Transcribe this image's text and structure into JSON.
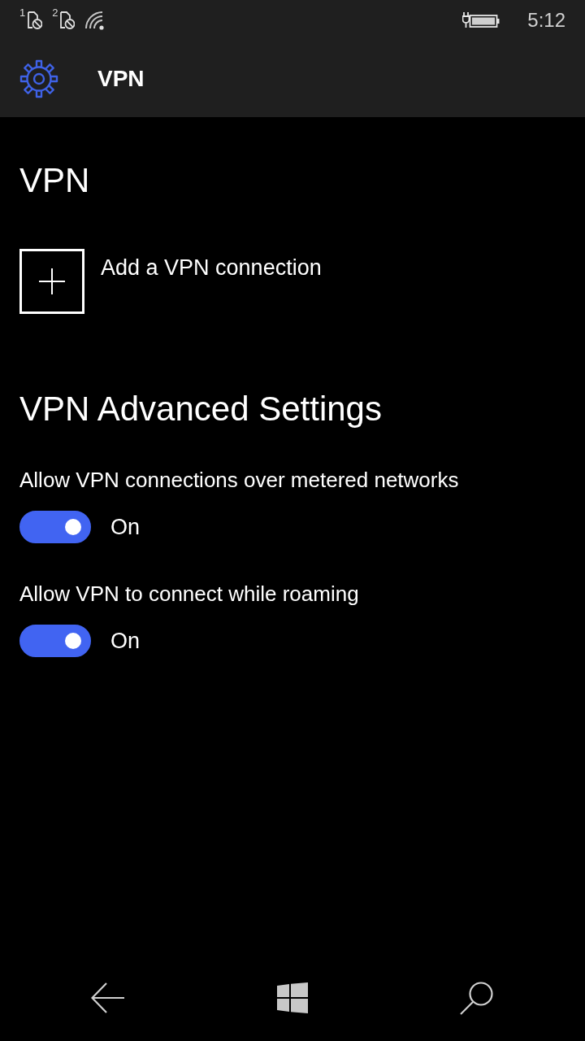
{
  "status_bar": {
    "sims": [
      {
        "number": "1"
      },
      {
        "number": "2"
      }
    ],
    "time": "5:12"
  },
  "header": {
    "title": "VPN"
  },
  "page_title": "VPN",
  "add_connection": {
    "label": "Add a VPN connection"
  },
  "section_title": "VPN Advanced Settings",
  "settings": [
    {
      "label": "Allow VPN connections over metered networks",
      "on": true,
      "state_text": "On"
    },
    {
      "label": "Allow VPN to connect while roaming",
      "on": true,
      "state_text": "On"
    }
  ]
}
